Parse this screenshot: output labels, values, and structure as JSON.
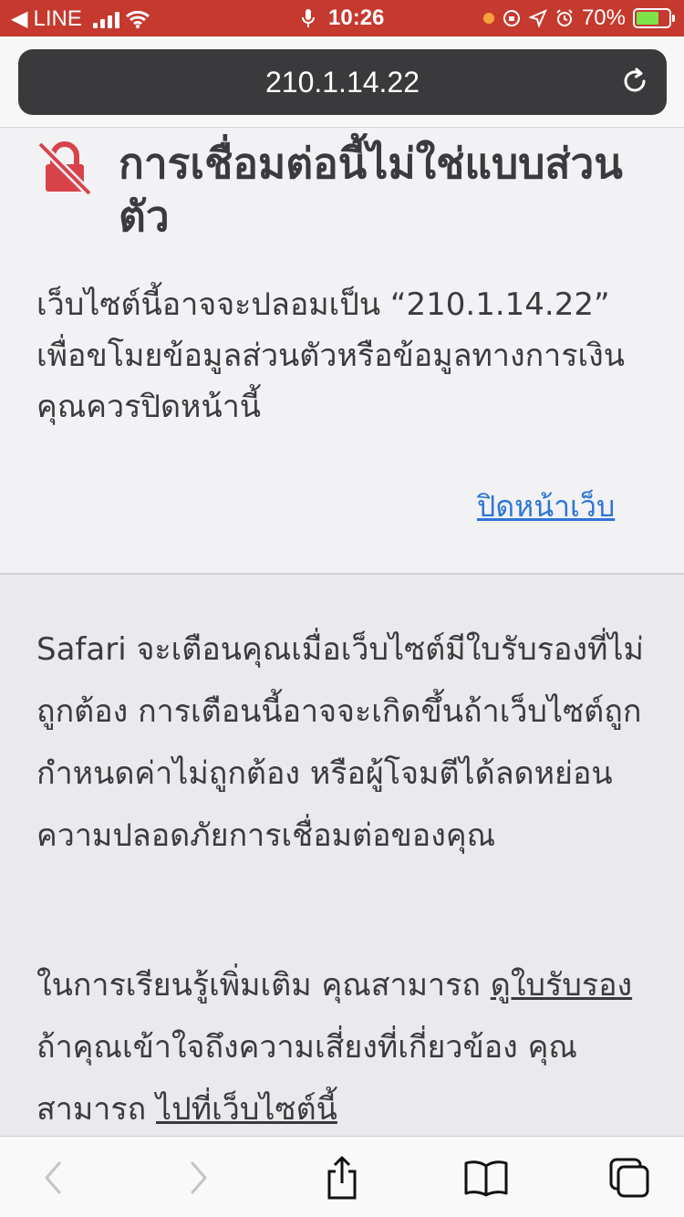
{
  "status_bar": {
    "back_app": "LINE",
    "time": "10:26",
    "battery": "70%",
    "battery_level": 0.7,
    "bar_color": "#c5392f"
  },
  "address_bar": {
    "url": "210.1.14.22",
    "reload_icon": "reload-icon"
  },
  "warning": {
    "icon": "broken-lock-icon",
    "title": "การเชื่อมต่อนี้ไม่ใช่แบบส่วนตัว",
    "body": "เว็บไซต์นี้อาจจะปลอมเป็น “210.1.14.22” เพื่อขโมยข้อมูลส่วนตัวหรือข้อมูลทางการเงิน คุณควรปิดหน้านี้",
    "close_link": "ปิดหน้าเว็บ"
  },
  "details": {
    "paragraph": "Safari จะเตือนคุณเมื่อเว็บไซต์มีใบรับรองที่ไม่ถูกต้อง การเตือนนี้อาจจะเกิดขึ้นถ้าเว็บไซต์ถูกกำหนดค่าไม่ถูกต้อง หรือผู้โจมตีได้ลดหย่อนความปลอดภัยการเชื่อมต่อของคุณ",
    "learn_prefix": "ในการเรียนรู้เพิ่มเติม คุณสามารถ ",
    "view_cert_link": "ดูใบรับรอง",
    "learn_middle": " ถ้าคุณเข้าใจถึงความเสี่ยงที่เกี่ยวข้อง คุณสามารถ ",
    "visit_site_link": "ไปที่เว็บไซต์นี้"
  },
  "toolbar": {
    "back_icon": "chevron-left-icon",
    "forward_icon": "chevron-right-icon",
    "share_icon": "share-icon",
    "bookmarks_icon": "book-icon",
    "tabs_icon": "tabs-icon"
  },
  "colors": {
    "link": "#2f75d9",
    "lock_red": "#d8434a"
  }
}
